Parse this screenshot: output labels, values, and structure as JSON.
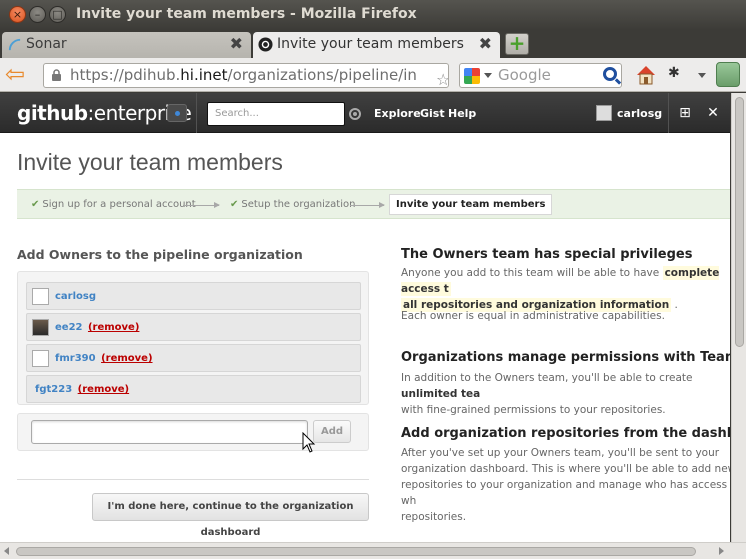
{
  "window": {
    "title": "Invite your team members - Mozilla Firefox"
  },
  "tabs": [
    {
      "label": "Sonar",
      "active": false
    },
    {
      "label": "Invite your team members",
      "active": true
    }
  ],
  "navbar": {
    "url_prefix": "https://pdihub.",
    "url_host": "hi.inet",
    "url_rest": "/organizations/pipeline/in",
    "search_placeholder": "Google"
  },
  "ghe": {
    "logo_bold": "github",
    "logo_light": ":enterprise",
    "search_placeholder": "Search...",
    "nav": [
      "Explore",
      "Gist",
      "Help"
    ],
    "username": "carlosg"
  },
  "page": {
    "title": "Invite your team members",
    "steps": [
      "Sign up for a personal account",
      "Setup the organization",
      "Invite your team members"
    ],
    "left_heading": "Add Owners to the pipeline organization",
    "members": [
      {
        "name": "carlosg",
        "remove": ""
      },
      {
        "name": "ee22",
        "remove": "(remove)"
      },
      {
        "name": "fmr390",
        "remove": "(remove)"
      },
      {
        "name": "fgt223",
        "remove": "(remove)"
      }
    ],
    "add_button": "Add",
    "done_button": "I'm done here, continue to the organization dashboard"
  },
  "info": {
    "s1_title": "The Owners team has special privileges",
    "s1_p1_a": "Anyone you add to this team will be able to have",
    "s1_p1_hl1": "complete access t",
    "s1_p1_hl2": "all repositories and organization information",
    "s1_p1_b": ".",
    "s1_p2": "Each owner is equal in administrative capabilities.",
    "s2_title": "Organizations manage permissions with Teams",
    "s2_p_a": "In addition to the Owners team, you'll be able to create",
    "s2_p_b": "unlimited tea",
    "s2_p_c": "with fine-grained permissions to your repositories.",
    "s3_title": "Add organization repositories from the dashboard",
    "s3_p1": "After you've set up your Owners team, you'll be sent to your",
    "s3_p2": "organization dashboard. This is where you'll be able to add new",
    "s3_p3": "repositories to your organization and manage who has access to wh",
    "s3_p4": "repositories."
  }
}
